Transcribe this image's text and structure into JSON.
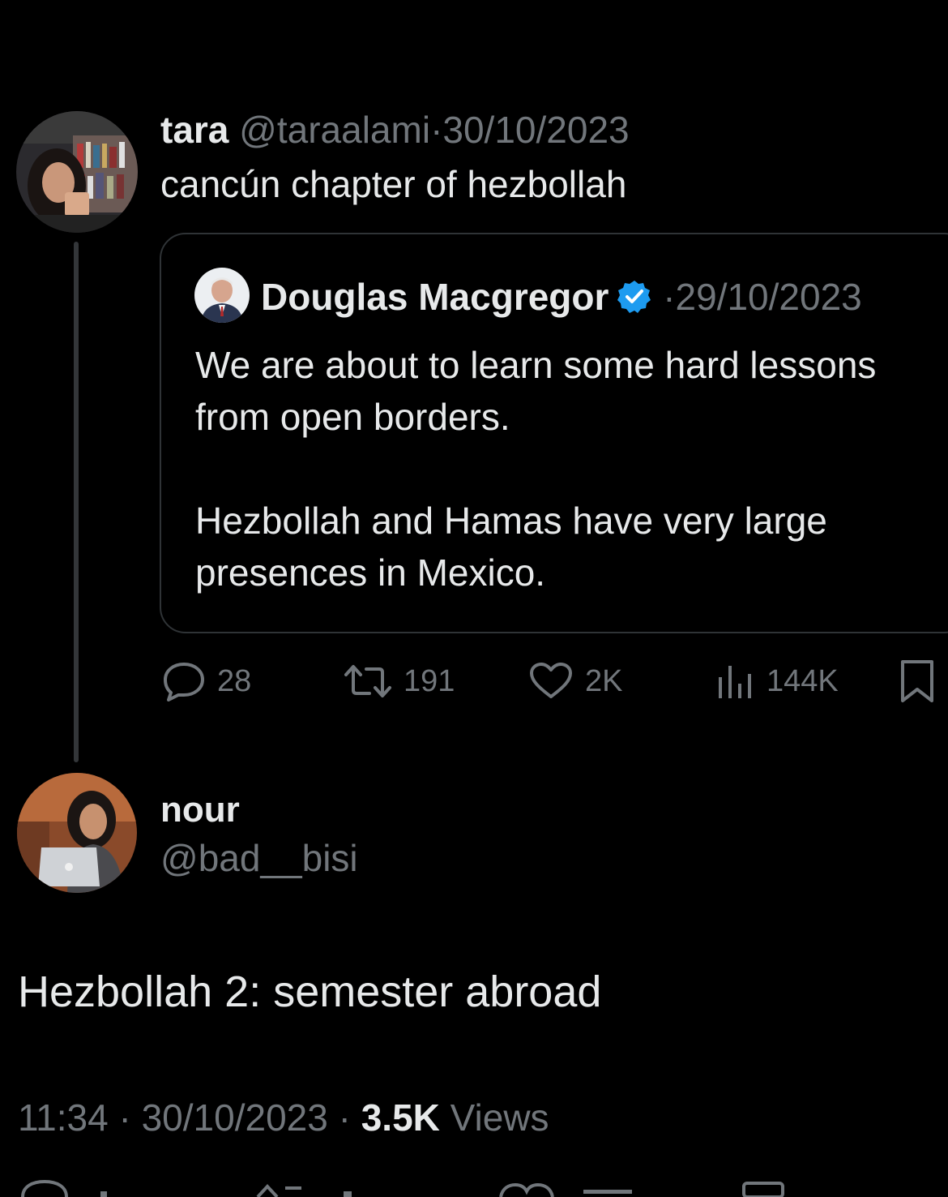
{
  "tweet": {
    "author_name": "tara",
    "author_handle": "@taraalami",
    "date": "30/10/2023",
    "text": "cancún chapter of hezbollah",
    "separator": "·"
  },
  "quote": {
    "author_name": "Douglas Macgregor",
    "verified_icon": "verified-badge-icon",
    "date": "29/10/2023",
    "separator": "·",
    "paragraph1": "We are about to learn some hard lessons from open borders.",
    "paragraph2": "Hezbollah and Hamas have very large presences in Mexico."
  },
  "actions": {
    "replies": "28",
    "retweets": "191",
    "likes": "2K",
    "views": "144K"
  },
  "reply": {
    "author_name": "nour",
    "author_handle": "@bad__bisi",
    "text": "Hezbollah 2: semester abroad",
    "time": "11:34",
    "date": "30/10/2023",
    "views_count": "3.5K",
    "views_label": "Views",
    "separator": "·"
  },
  "colors": {
    "background": "#000000",
    "text": "#e7e9ea",
    "muted": "#71767b",
    "border": "#2f3336",
    "verified": "#1d9bf0"
  }
}
